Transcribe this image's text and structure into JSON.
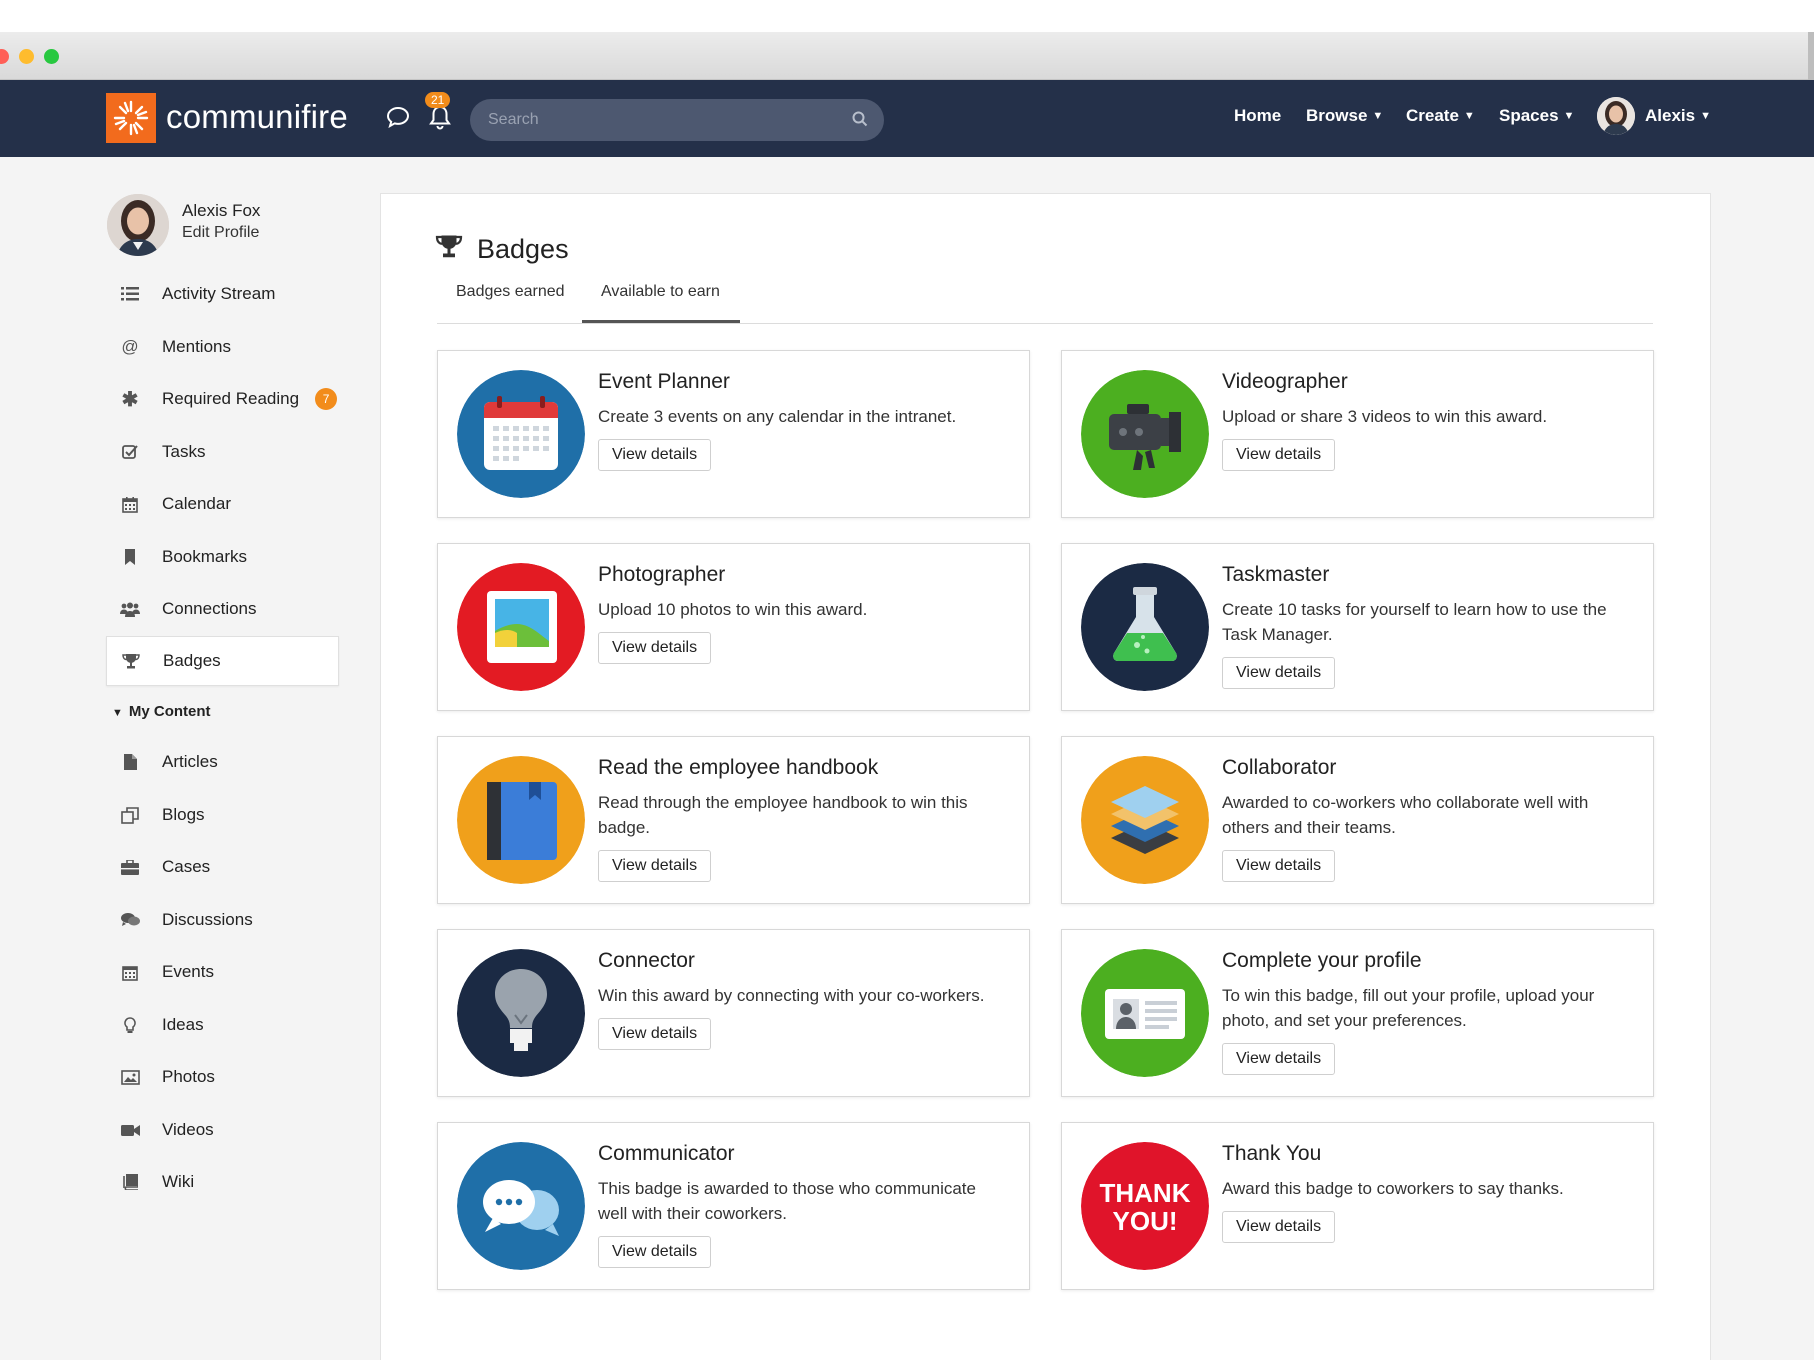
{
  "app": {
    "brand": "communifire",
    "colors": {
      "header": "#243049",
      "accent": "#f26b1d",
      "badge": "#f28c1b"
    }
  },
  "header": {
    "notifications_count": "21",
    "search_placeholder": "Search",
    "nav": {
      "home": "Home",
      "browse": "Browse",
      "create": "Create",
      "spaces": "Spaces",
      "user": "Alexis"
    }
  },
  "sidebar": {
    "profile": {
      "name": "Alexis Fox",
      "edit": "Edit Profile"
    },
    "items": [
      {
        "label": "Activity Stream",
        "icon": "list-icon"
      },
      {
        "label": "Mentions",
        "icon": "at-icon"
      },
      {
        "label": "Required Reading",
        "icon": "asterisk-icon",
        "badge": "7"
      },
      {
        "label": "Tasks",
        "icon": "checkbox-icon"
      },
      {
        "label": "Calendar",
        "icon": "calendar-icon"
      },
      {
        "label": "Bookmarks",
        "icon": "bookmark-icon"
      },
      {
        "label": "Connections",
        "icon": "users-icon"
      },
      {
        "label": "Badges",
        "icon": "trophy-icon",
        "active": true
      }
    ],
    "section": "My Content",
    "content_items": [
      {
        "label": "Articles",
        "icon": "file-icon"
      },
      {
        "label": "Blogs",
        "icon": "blogs-icon"
      },
      {
        "label": "Cases",
        "icon": "briefcase-icon"
      },
      {
        "label": "Discussions",
        "icon": "comments-icon"
      },
      {
        "label": "Events",
        "icon": "calendar-icon"
      },
      {
        "label": "Ideas",
        "icon": "lightbulb-icon"
      },
      {
        "label": "Photos",
        "icon": "image-icon"
      },
      {
        "label": "Videos",
        "icon": "video-icon"
      },
      {
        "label": "Wiki",
        "icon": "book-icon"
      }
    ]
  },
  "main": {
    "title": "Badges",
    "tabs": [
      {
        "label": "Badges earned"
      },
      {
        "label": "Available to earn",
        "active": true
      }
    ],
    "view_details": "View details",
    "badges": [
      {
        "title": "Event Planner",
        "desc": "Create 3 events on any calendar in the intranet.",
        "icon": "calendar-badge-icon",
        "color": "#1f6fa8"
      },
      {
        "title": "Videographer",
        "desc": "Upload or share 3 videos to win this award.",
        "icon": "video-camera-badge-icon",
        "color": "#4caf20"
      },
      {
        "title": "Photographer",
        "desc": "Upload 10 photos to win this award.",
        "icon": "photo-badge-icon",
        "color": "#e31b23"
      },
      {
        "title": "Taskmaster",
        "desc": "Create 10 tasks for yourself to learn how to use the Task Manager.",
        "icon": "flask-badge-icon",
        "color": "#1b2a44"
      },
      {
        "title": "Read the employee handbook",
        "desc": "Read through the employee handbook to win this badge.",
        "icon": "handbook-badge-icon",
        "color": "#f0a01b"
      },
      {
        "title": "Collaborator",
        "desc": "Awarded to co-workers who collaborate well with others and their teams.",
        "icon": "layers-badge-icon",
        "color": "#f0a01b"
      },
      {
        "title": "Connector",
        "desc": "Win this award by connecting with your co-workers.",
        "icon": "lightbulb-badge-icon",
        "color": "#1b2a44"
      },
      {
        "title": "Complete your profile",
        "desc": "To win this badge, fill out your profile, upload your photo, and set your preferences.",
        "icon": "id-card-badge-icon",
        "color": "#4caf20"
      },
      {
        "title": "Communicator",
        "desc": "This badge is awarded to those who communicate well with their coworkers.",
        "icon": "speech-bubbles-badge-icon",
        "color": "#1f6fa8"
      },
      {
        "title": "Thank You",
        "desc": "Award this badge to coworkers to say thanks.",
        "icon": "thank-you-badge-icon",
        "color": "#e0142a",
        "badge_text": [
          "THANK",
          "YOU!"
        ]
      }
    ]
  }
}
